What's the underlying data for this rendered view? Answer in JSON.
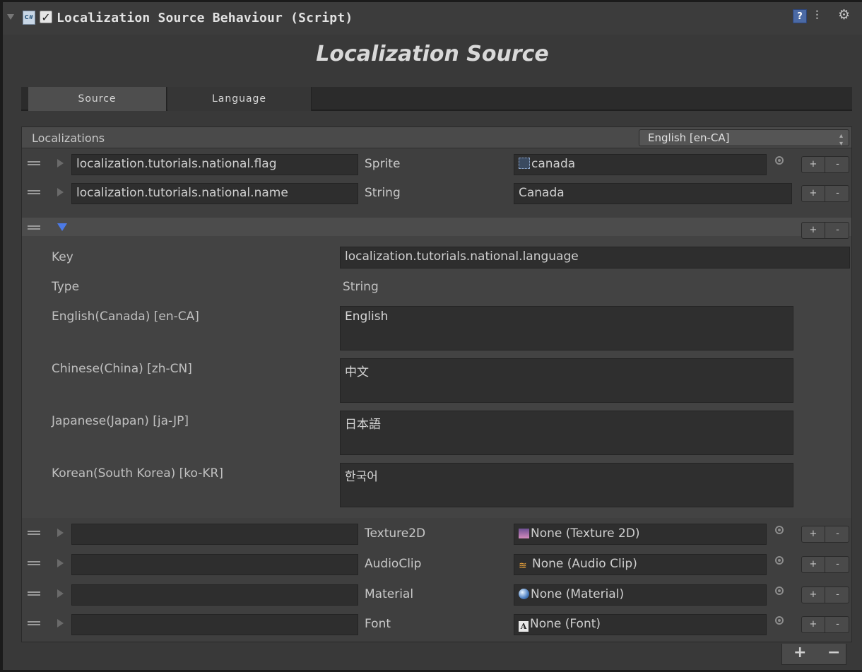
{
  "component": {
    "title": "Localization Source Behaviour (Script)",
    "cs_icon": "C#",
    "check": "✓",
    "help_icon": "?",
    "preset_icon": "⚙",
    "gear_icon": "⚙"
  },
  "heading": "Localization Source",
  "tabs": [
    {
      "label": "Source",
      "active": true
    },
    {
      "label": "Language",
      "active": false
    }
  ],
  "localizations": {
    "label": "Localizations",
    "language_select": "English [en-CA]"
  },
  "buttons": {
    "plus": "+",
    "minus": "-"
  },
  "rows_top": [
    {
      "key": "localization.tutorials.national.flag",
      "type": "Sprite",
      "value": "canada",
      "icon": "sprite-icon",
      "has_picker": true
    },
    {
      "key": "localization.tutorials.national.name",
      "type": "String",
      "value": "Canada",
      "has_picker": false
    }
  ],
  "expanded": {
    "key_label": "Key",
    "key_value": "localization.tutorials.national.language",
    "type_label": "Type",
    "type_value": "String",
    "translations": [
      {
        "label": "English(Canada) [en-CA]",
        "value": "English"
      },
      {
        "label": "Chinese(China) [zh-CN]",
        "value": "中文"
      },
      {
        "label": "Japanese(Japan) [ja-JP]",
        "value": "日本語"
      },
      {
        "label": "Korean(South Korea) [ko-KR]",
        "value": "한국어"
      }
    ]
  },
  "rows_bottom": [
    {
      "key": "",
      "type": "Texture2D",
      "value": "None (Texture 2D)",
      "icon": "texture-icon"
    },
    {
      "key": "",
      "type": "AudioClip",
      "value": "None (Audio Clip)",
      "icon": "audio-clip-icon"
    },
    {
      "key": "",
      "type": "Material",
      "value": "None (Material)",
      "icon": "material-icon"
    },
    {
      "key": "",
      "type": "Font",
      "value": "None (Font)",
      "icon": "font-icon"
    }
  ],
  "footer": {
    "plus": "+",
    "minus": "−"
  },
  "colors": {
    "accent_triangle": "#4c7ae6",
    "panel": "#393939"
  }
}
